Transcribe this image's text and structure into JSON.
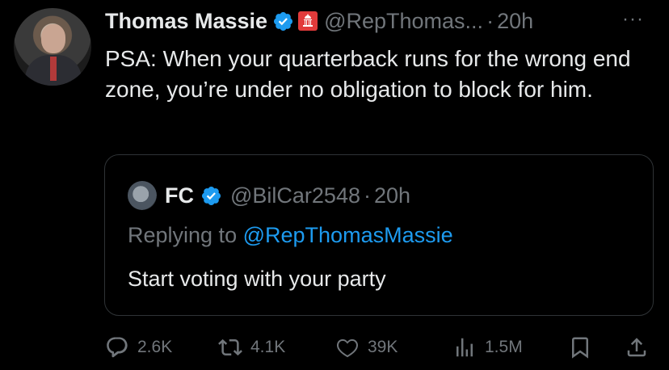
{
  "tweet": {
    "author_name": "Thomas Massie",
    "handle": "@RepThomas...",
    "dot": "·",
    "time": "20h",
    "text": "PSA: When your quarterback runs for the wrong end zone, you’re under no obligation to block for him.",
    "more": "···"
  },
  "quoted": {
    "author_name": "FC",
    "handle": "@BilCar2548",
    "dot": "·",
    "time": "20h",
    "replying_prefix": "Replying to",
    "replying_handle": "@RepThomasMassie",
    "text": "Start voting with your party"
  },
  "actions": {
    "replies": "2.6K",
    "reposts": "4.1K",
    "likes": "39K",
    "views": "1.5M"
  },
  "colors": {
    "background": "#000000",
    "text": "#e7e9ea",
    "muted": "#71767b",
    "link": "#1d9bf0",
    "verified": "#1d9bf0",
    "border": "#2f3336"
  }
}
